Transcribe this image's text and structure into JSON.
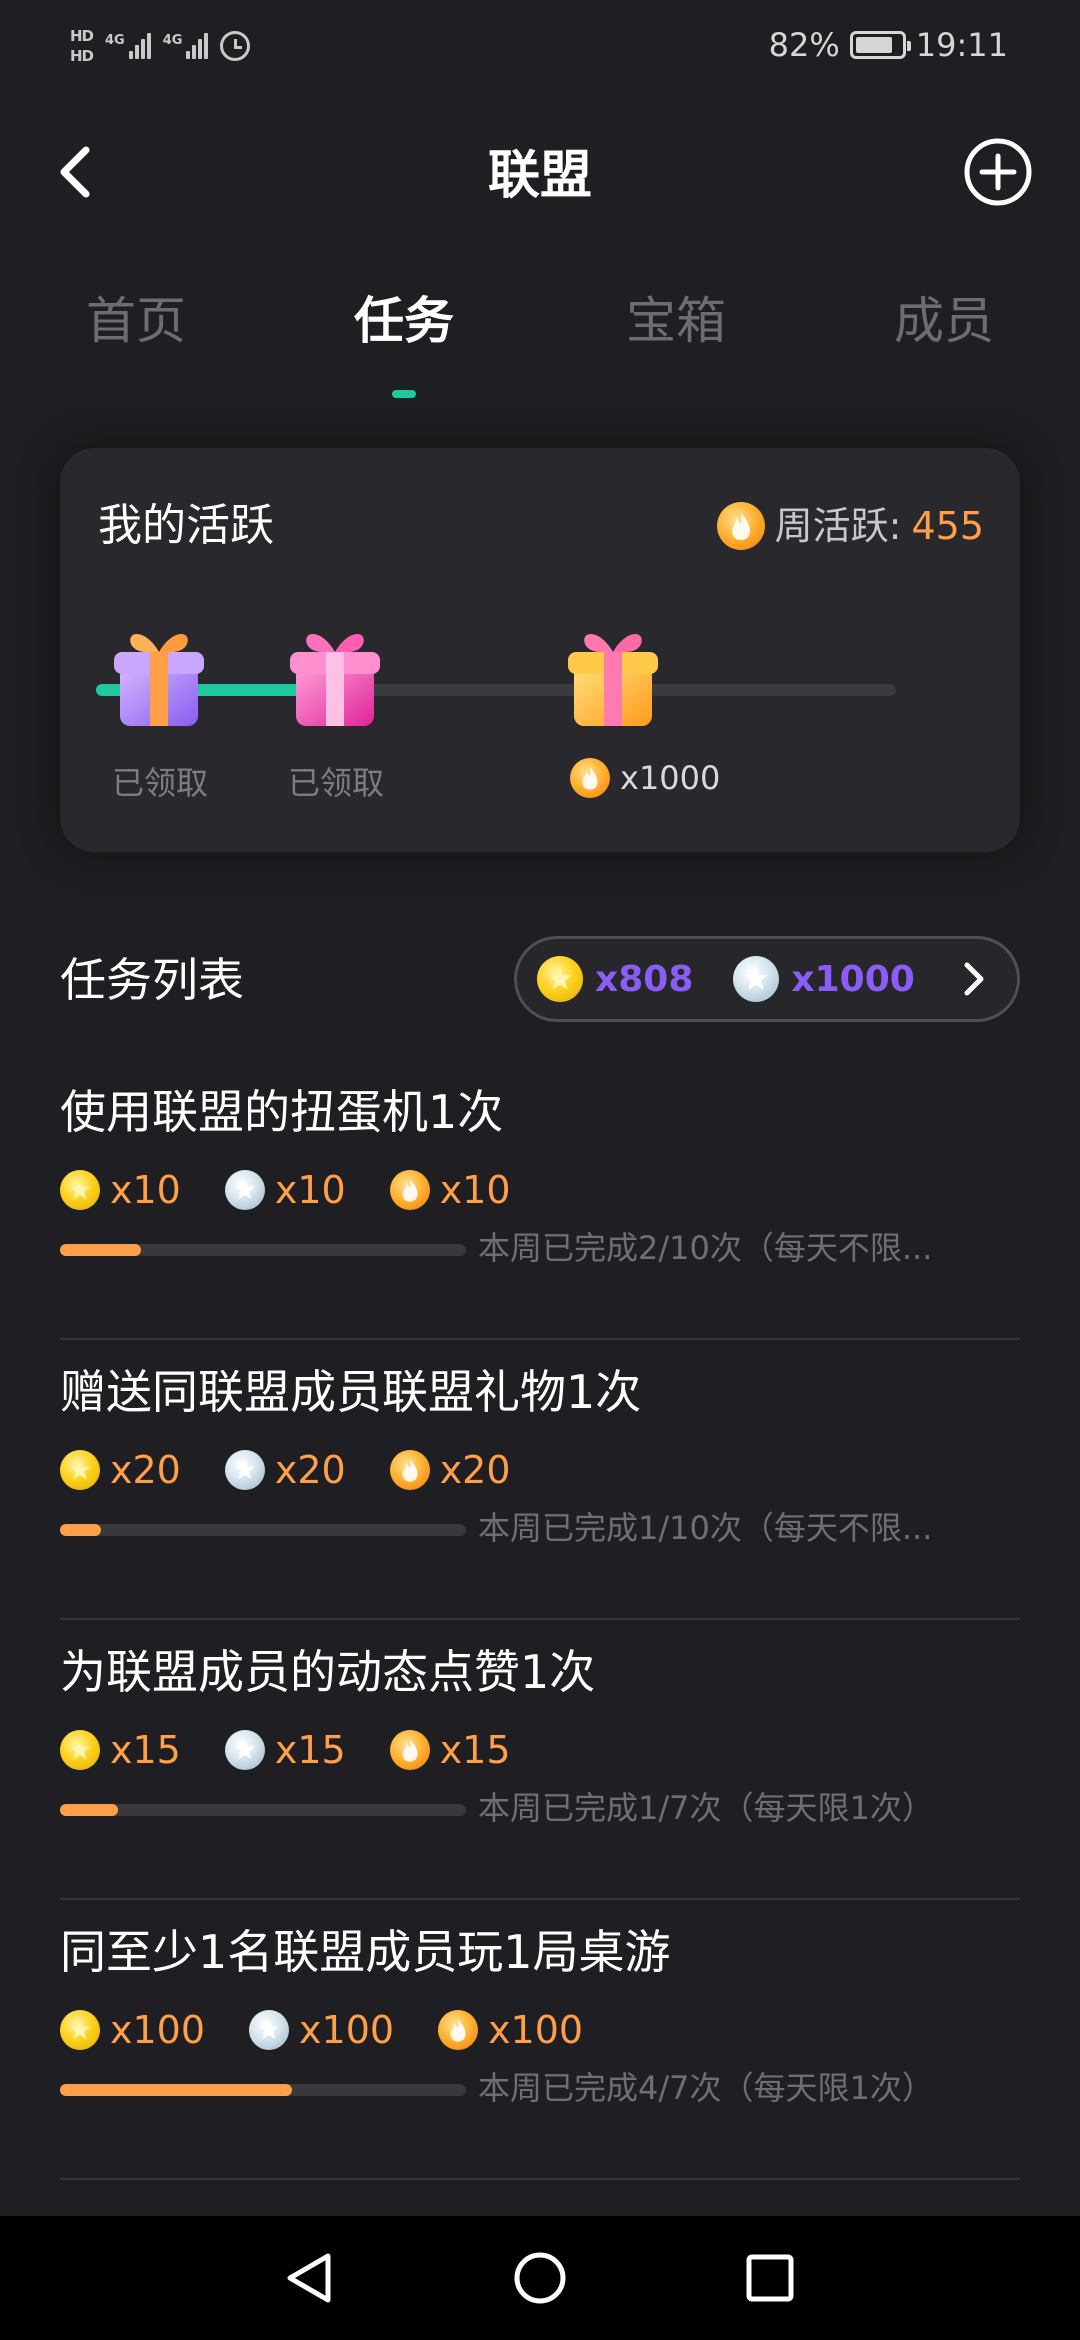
{
  "status_bar": {
    "hd1": "HD",
    "hd2": "HD",
    "net1": "4G",
    "net2": "4G",
    "battery": "82%",
    "time": "19:11"
  },
  "header": {
    "title": "联盟",
    "icons": {
      "back": "back-arrow-icon",
      "add": "add-circle-icon"
    }
  },
  "tabs": [
    {
      "label": "首页",
      "active": false
    },
    {
      "label": "任务",
      "active": true
    },
    {
      "label": "宝箱",
      "active": false
    },
    {
      "label": "成员",
      "active": false
    }
  ],
  "activity": {
    "title": "我的活跃",
    "weekly_label": "周活跃:",
    "weekly_value": "455",
    "progress_fraction": 0.32,
    "milestones": [
      {
        "status": "已领取",
        "color": "purple"
      },
      {
        "status": "已领取",
        "color": "pink"
      },
      {
        "reward": "x1000",
        "color": "orange"
      }
    ]
  },
  "task_list": {
    "title": "任务列表",
    "gold_balance": "x808",
    "silver_balance": "x1000"
  },
  "tasks": [
    {
      "title": "使用联盟的扭蛋机1次",
      "gold": "x10",
      "silver": "x10",
      "fire": "x10",
      "progress": 0.2,
      "progress_text": "本周已完成2/10次（每天不限..."
    },
    {
      "title": "赠送同联盟成员联盟礼物1次",
      "gold": "x20",
      "silver": "x20",
      "fire": "x20",
      "progress": 0.1,
      "progress_text": "本周已完成1/10次（每天不限..."
    },
    {
      "title": "为联盟成员的动态点赞1次",
      "gold": "x15",
      "silver": "x15",
      "fire": "x15",
      "progress": 0.1428,
      "progress_text": "本周已完成1/7次（每天限1次）"
    },
    {
      "title": "同至少1名联盟成员玩1局桌游",
      "gold": "x100",
      "silver": "x100",
      "fire": "x100",
      "progress": 0.5714,
      "progress_text": "本周已完成4/7次（每天限1次）"
    }
  ],
  "colors": {
    "accent_green": "#1ec9a0",
    "accent_orange": "#ff9f4a",
    "accent_purple": "#8b5cf6",
    "background": "#1f1f23"
  }
}
